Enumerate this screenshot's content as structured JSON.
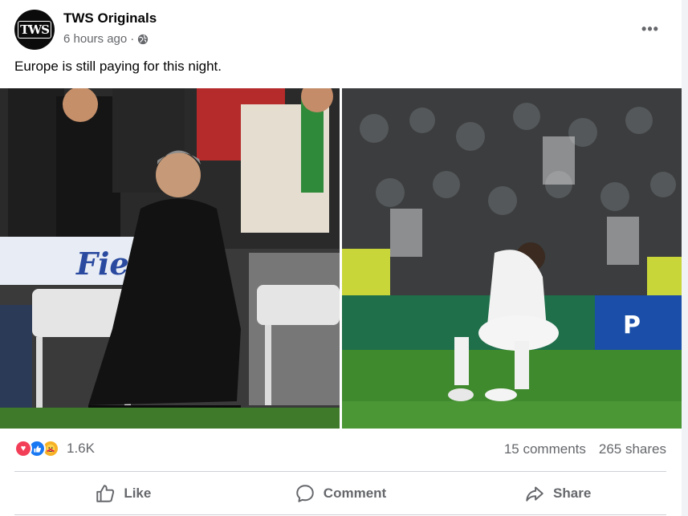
{
  "post": {
    "page_name": "TWS Originals",
    "avatar_text": "TWS",
    "time": "6 hours ago",
    "separator": "·",
    "more_label": "•••",
    "text": "Europe is still paying for this night."
  },
  "images": [
    {
      "alt": "Manager kneeling on the touchline in a black coat",
      "banner_text": "Fiele"
    },
    {
      "alt": "Player in white kit crouching with hands on head"
    }
  ],
  "stats": {
    "reactions": [
      "love-icon",
      "like-icon",
      "care-icon"
    ],
    "reaction_count": "1.6K",
    "comments": "15 comments",
    "shares": "265 shares"
  },
  "actions": {
    "like": "Like",
    "comment": "Comment",
    "share": "Share"
  },
  "colors": {
    "accent": "#1877f2",
    "secondary_text": "#65676b",
    "love": "#f33e58",
    "care": "#f7b125",
    "pitch": "#3e7a2a"
  }
}
